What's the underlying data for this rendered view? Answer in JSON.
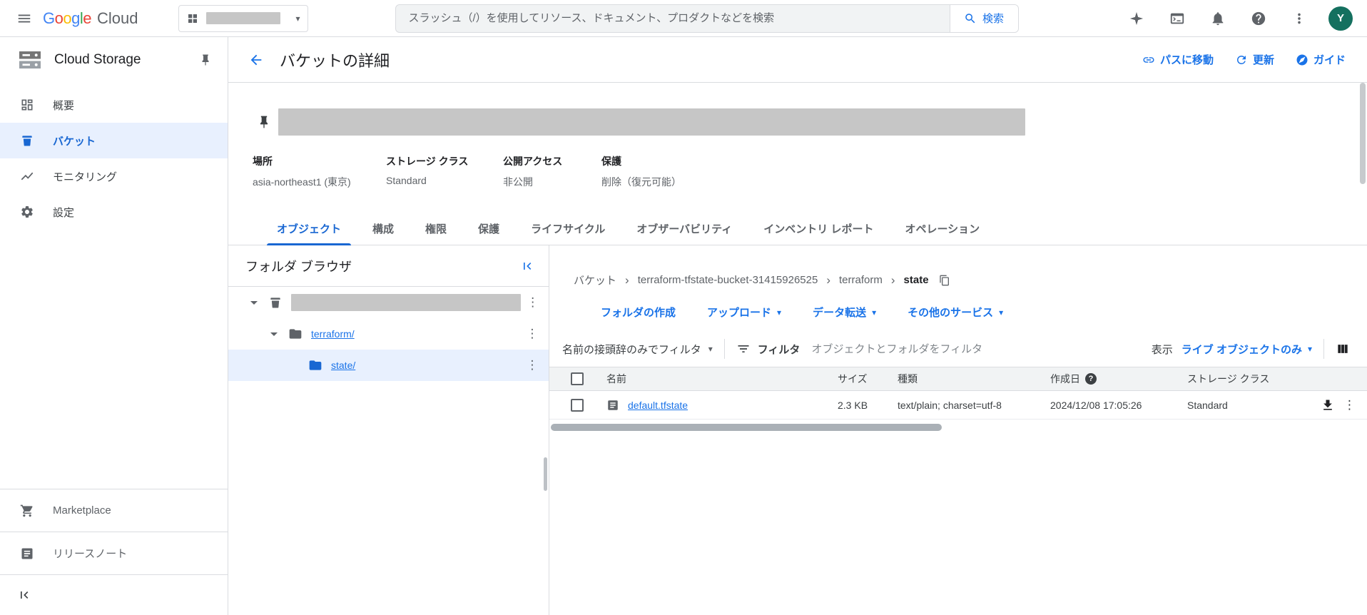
{
  "colors": {
    "accent_blue": "#1a73e8",
    "active_blue": "#1967d2",
    "selected_bg": "#e8f0fe",
    "border": "#dadce0",
    "text_primary": "#202124",
    "text_secondary": "#5f6368",
    "avatar_bg": "#14705f",
    "redacted_gray": "#c6c6c6"
  },
  "icons": {
    "caret_down": "▾",
    "more_vert": "⋮",
    "breadcrumb_sep": "›",
    "help_q": "?"
  },
  "header": {
    "logo_chars": [
      "G",
      "o",
      "o",
      "g",
      "l",
      "e"
    ],
    "logo_cloud": "Cloud",
    "search_placeholder": "スラッシュ（/）を使用してリソース、ドキュメント、プロダクトなどを検索",
    "search_button_label": "検索",
    "avatar_letter": "Y"
  },
  "sidebar": {
    "title": "Cloud Storage",
    "items": [
      {
        "label": "概要"
      },
      {
        "label": "バケット"
      },
      {
        "label": "モニタリング"
      },
      {
        "label": "設定"
      }
    ],
    "footer_items": [
      {
        "label": "Marketplace"
      },
      {
        "label": "リリースノート"
      }
    ]
  },
  "page": {
    "title": "バケットの詳細",
    "actions": [
      {
        "label": "パスに移動"
      },
      {
        "label": "更新"
      },
      {
        "label": "ガイド"
      }
    ]
  },
  "bucket": {
    "fields": [
      {
        "label": "場所",
        "value": "asia-northeast1 (東京)"
      },
      {
        "label": "ストレージ クラス",
        "value": "Standard"
      },
      {
        "label": "公開アクセス",
        "value": "非公開"
      },
      {
        "label": "保護",
        "value": "削除（復元可能）"
      }
    ]
  },
  "tabs": [
    {
      "label": "オブジェクト"
    },
    {
      "label": "構成"
    },
    {
      "label": "権限"
    },
    {
      "label": "保護"
    },
    {
      "label": "ライフサイクル"
    },
    {
      "label": "オブザーバビリティ"
    },
    {
      "label": "インベントリ レポート"
    },
    {
      "label": "オペレーション"
    }
  ],
  "folder_browser": {
    "title": "フォルダ ブラウザ",
    "tree": [
      {
        "label": "terraform/"
      },
      {
        "label": "state/"
      }
    ]
  },
  "objects": {
    "breadcrumb": [
      "バケット",
      "terraform-tfstate-bucket-31415926525",
      "terraform",
      "state"
    ],
    "actions": [
      {
        "label": "フォルダの作成"
      },
      {
        "label": "アップロード"
      },
      {
        "label": "データ転送"
      },
      {
        "label": "その他のサービス"
      }
    ],
    "filter": {
      "prefix_label": "名前の接頭辞のみでフィルタ",
      "filter_label": "フィルタ",
      "placeholder": "オブジェクトとフォルダをフィルタ",
      "display_label": "表示",
      "display_value": "ライブ オブジェクトのみ"
    },
    "table": {
      "headers": [
        "名前",
        "サイズ",
        "種類",
        "作成日",
        "ストレージ クラス"
      ],
      "rows": [
        {
          "name": "default.tfstate",
          "size": "2.3 KB",
          "type": "text/plain; charset=utf-8",
          "created": "2024/12/08 17:05:26",
          "storage_class": "Standard"
        }
      ]
    }
  }
}
